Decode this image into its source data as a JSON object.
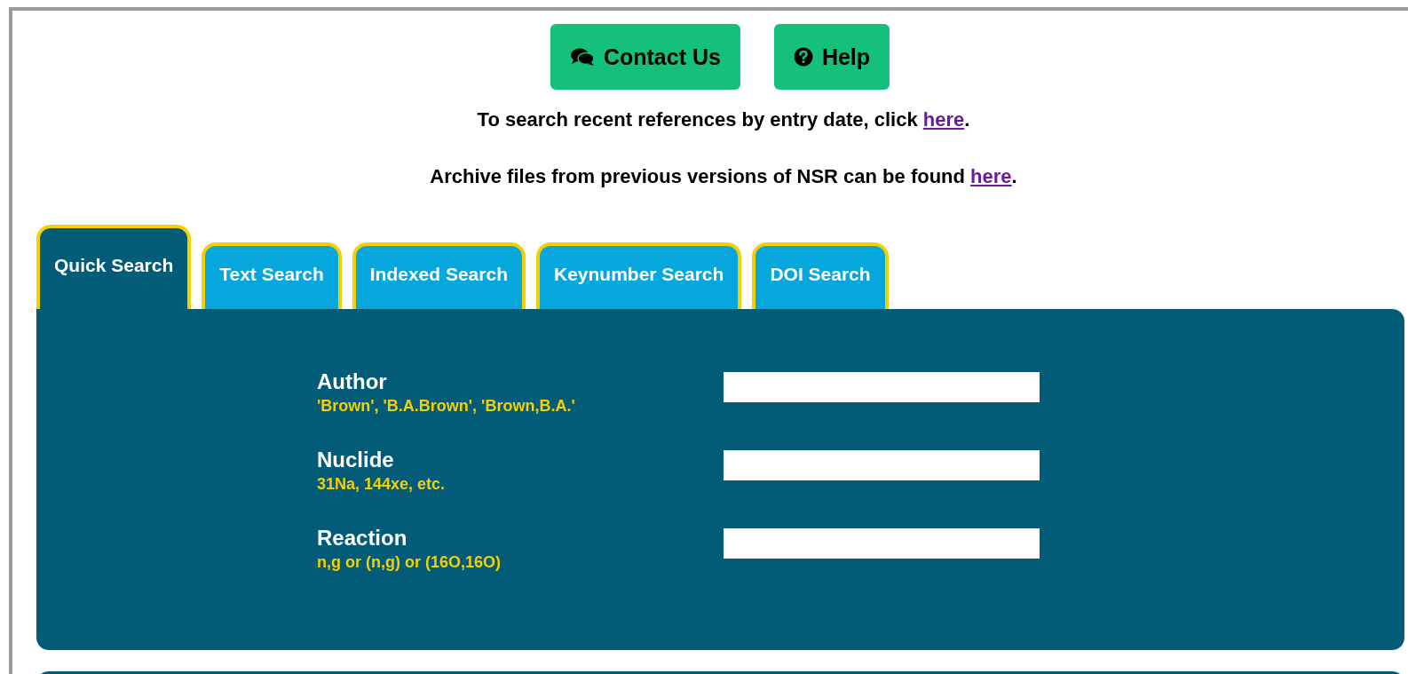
{
  "buttons": [
    {
      "label": "Contact Us",
      "kind": "comments"
    },
    {
      "label": "Help",
      "kind": "question"
    }
  ],
  "notices": [
    {
      "before": "To search recent references by entry date, click ",
      "link": "here",
      "after": "."
    },
    {
      "before": "Archive files from previous versions of NSR can be found ",
      "link": "here",
      "after": "."
    }
  ],
  "tabs": [
    {
      "label": "Quick Search",
      "selected": true
    },
    {
      "label": "Text Search",
      "selected": false
    },
    {
      "label": "Indexed Search",
      "selected": false
    },
    {
      "label": "Keynumber Search",
      "selected": false
    },
    {
      "label": "DOI Search",
      "selected": false
    }
  ],
  "fields": [
    {
      "label": "Author",
      "hint": "'Brown', 'B.A.Brown', 'Brown,B.A.'"
    },
    {
      "label": "Nuclide",
      "hint": "31Na, 144xe, etc."
    },
    {
      "label": "Reaction",
      "hint": "n,g or (n,g) or (16O,16O)"
    }
  ]
}
